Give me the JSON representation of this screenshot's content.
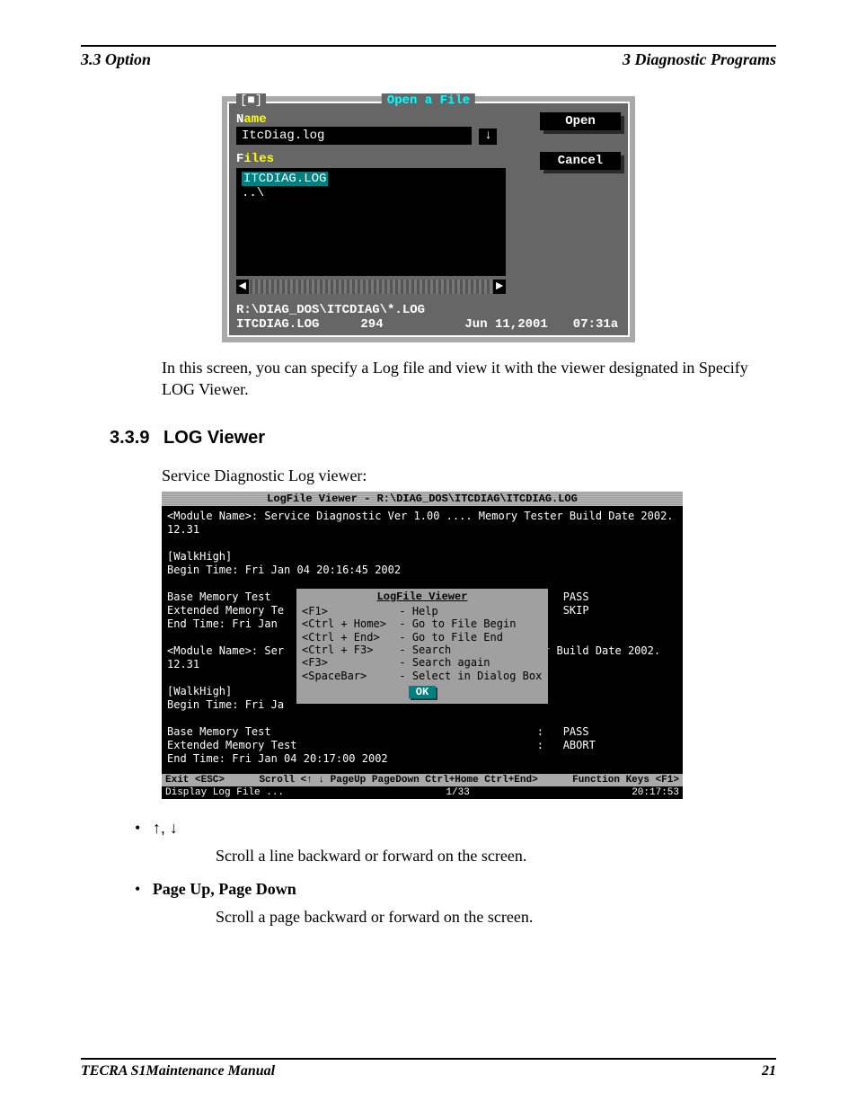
{
  "header": {
    "left": "3.3 Option",
    "right": "3  Diagnostic Programs"
  },
  "footer": {
    "left": "TECRA S1Maintenance Manual",
    "right": "21"
  },
  "shot1": {
    "title": "Open a File",
    "close_glyph": "[■]",
    "name_label_pre": "N",
    "name_label_post": "ame",
    "name_value": "ItcDiag.log",
    "history_glyph": "↓",
    "open_label": "Open",
    "files_label_pre": "F",
    "files_label_post": "iles",
    "file_selected": "ITCDIAG.LOG",
    "file_up": "..\\",
    "cancel_label": "Cancel",
    "status_line1": "R:\\DIAG_DOS\\ITCDIAG\\*.LOG",
    "status_file": "ITCDIAG.LOG",
    "status_size": "294",
    "status_date": "Jun 11,2001",
    "status_time": "07:31a"
  },
  "para1": "In this screen, you can specify a Log file and view it with the viewer designated in Specify LOG Viewer.",
  "section": {
    "num": "3.3.9",
    "title": "LOG Viewer"
  },
  "para2": "Service Diagnostic Log viewer:",
  "shot2": {
    "titlebar": "LogFile Viewer - R:\\DIAG_DOS\\ITCDIAG\\ITCDIAG.LOG",
    "bg_text": "<Module Name>: Service Diagnostic Ver 1.00 .... Memory Tester Build Date 2002.\n12.31\n\n[WalkHigh]\nBegin Time: Fri Jan 04 20:16:45 2002\n\nBase Memory Test                                         :   PASS\nExtended Memory Te                                       :   SKIP\nEnd Time: Fri Jan\n\n<Module Name>: Ser                                       er Build Date 2002.\n12.31\n\n[WalkHigh]\nBegin Time: Fri Ja\n\nBase Memory Test                                         :   PASS\nExtended Memory Test                                     :   ABORT\nEnd Time: Fri Jan 04 20:17:00 2002",
    "popup_title": "LogFile Viewer",
    "popup_body": "<F1>           - Help\n<Ctrl + Home>  - Go to File Begin\n<Ctrl + End>   - Go to File End\n<Ctrl + F3>    - Search\n<F3>           - Search again\n<SpaceBar>     - Select in Dialog Box",
    "popup_ok": "OK",
    "fn_left": "Exit <ESC>",
    "fn_mid": "Scroll <↑ ↓ PageUp PageDown Ctrl+Home Ctrl+End>",
    "fn_right": "Function Keys <F1>",
    "status_left": "Display Log File ...",
    "status_mid": "1/33",
    "status_right": "20:17:53"
  },
  "bullets": [
    {
      "label": "↑, ↓",
      "bold": false,
      "desc": "Scroll a line backward or forward on the screen."
    },
    {
      "label": "Page Up, Page Down",
      "bold": true,
      "desc": "Scroll a page backward or forward on the screen."
    }
  ]
}
